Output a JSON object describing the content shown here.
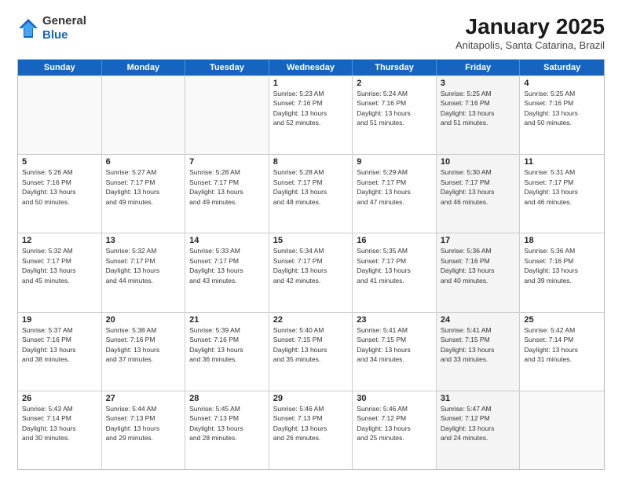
{
  "header": {
    "logo_general": "General",
    "logo_blue": "Blue",
    "month_title": "January 2025",
    "subtitle": "Anitapolis, Santa Catarina, Brazil"
  },
  "weekdays": [
    "Sunday",
    "Monday",
    "Tuesday",
    "Wednesday",
    "Thursday",
    "Friday",
    "Saturday"
  ],
  "rows": [
    [
      {
        "day": "",
        "lines": [],
        "empty": true
      },
      {
        "day": "",
        "lines": [],
        "empty": true
      },
      {
        "day": "",
        "lines": [],
        "empty": true
      },
      {
        "day": "1",
        "lines": [
          "Sunrise: 5:23 AM",
          "Sunset: 7:16 PM",
          "Daylight: 13 hours",
          "and 52 minutes."
        ]
      },
      {
        "day": "2",
        "lines": [
          "Sunrise: 5:24 AM",
          "Sunset: 7:16 PM",
          "Daylight: 13 hours",
          "and 51 minutes."
        ]
      },
      {
        "day": "3",
        "lines": [
          "Sunrise: 5:25 AM",
          "Sunset: 7:16 PM",
          "Daylight: 13 hours",
          "and 51 minutes."
        ],
        "shaded": true
      },
      {
        "day": "4",
        "lines": [
          "Sunrise: 5:25 AM",
          "Sunset: 7:16 PM",
          "Daylight: 13 hours",
          "and 50 minutes."
        ]
      }
    ],
    [
      {
        "day": "5",
        "lines": [
          "Sunrise: 5:26 AM",
          "Sunset: 7:16 PM",
          "Daylight: 13 hours",
          "and 50 minutes."
        ]
      },
      {
        "day": "6",
        "lines": [
          "Sunrise: 5:27 AM",
          "Sunset: 7:17 PM",
          "Daylight: 13 hours",
          "and 49 minutes."
        ]
      },
      {
        "day": "7",
        "lines": [
          "Sunrise: 5:28 AM",
          "Sunset: 7:17 PM",
          "Daylight: 13 hours",
          "and 49 minutes."
        ]
      },
      {
        "day": "8",
        "lines": [
          "Sunrise: 5:28 AM",
          "Sunset: 7:17 PM",
          "Daylight: 13 hours",
          "and 48 minutes."
        ]
      },
      {
        "day": "9",
        "lines": [
          "Sunrise: 5:29 AM",
          "Sunset: 7:17 PM",
          "Daylight: 13 hours",
          "and 47 minutes."
        ]
      },
      {
        "day": "10",
        "lines": [
          "Sunrise: 5:30 AM",
          "Sunset: 7:17 PM",
          "Daylight: 13 hours",
          "and 46 minutes."
        ],
        "shaded": true
      },
      {
        "day": "11",
        "lines": [
          "Sunrise: 5:31 AM",
          "Sunset: 7:17 PM",
          "Daylight: 13 hours",
          "and 46 minutes."
        ]
      }
    ],
    [
      {
        "day": "12",
        "lines": [
          "Sunrise: 5:32 AM",
          "Sunset: 7:17 PM",
          "Daylight: 13 hours",
          "and 45 minutes."
        ]
      },
      {
        "day": "13",
        "lines": [
          "Sunrise: 5:32 AM",
          "Sunset: 7:17 PM",
          "Daylight: 13 hours",
          "and 44 minutes."
        ]
      },
      {
        "day": "14",
        "lines": [
          "Sunrise: 5:33 AM",
          "Sunset: 7:17 PM",
          "Daylight: 13 hours",
          "and 43 minutes."
        ]
      },
      {
        "day": "15",
        "lines": [
          "Sunrise: 5:34 AM",
          "Sunset: 7:17 PM",
          "Daylight: 13 hours",
          "and 42 minutes."
        ]
      },
      {
        "day": "16",
        "lines": [
          "Sunrise: 5:35 AM",
          "Sunset: 7:17 PM",
          "Daylight: 13 hours",
          "and 41 minutes."
        ]
      },
      {
        "day": "17",
        "lines": [
          "Sunrise: 5:36 AM",
          "Sunset: 7:16 PM",
          "Daylight: 13 hours",
          "and 40 minutes."
        ],
        "shaded": true
      },
      {
        "day": "18",
        "lines": [
          "Sunrise: 5:36 AM",
          "Sunset: 7:16 PM",
          "Daylight: 13 hours",
          "and 39 minutes."
        ]
      }
    ],
    [
      {
        "day": "19",
        "lines": [
          "Sunrise: 5:37 AM",
          "Sunset: 7:16 PM",
          "Daylight: 13 hours",
          "and 38 minutes."
        ]
      },
      {
        "day": "20",
        "lines": [
          "Sunrise: 5:38 AM",
          "Sunset: 7:16 PM",
          "Daylight: 13 hours",
          "and 37 minutes."
        ]
      },
      {
        "day": "21",
        "lines": [
          "Sunrise: 5:39 AM",
          "Sunset: 7:16 PM",
          "Daylight: 13 hours",
          "and 36 minutes."
        ]
      },
      {
        "day": "22",
        "lines": [
          "Sunrise: 5:40 AM",
          "Sunset: 7:15 PM",
          "Daylight: 13 hours",
          "and 35 minutes."
        ]
      },
      {
        "day": "23",
        "lines": [
          "Sunrise: 5:41 AM",
          "Sunset: 7:15 PM",
          "Daylight: 13 hours",
          "and 34 minutes."
        ]
      },
      {
        "day": "24",
        "lines": [
          "Sunrise: 5:41 AM",
          "Sunset: 7:15 PM",
          "Daylight: 13 hours",
          "and 33 minutes."
        ],
        "shaded": true
      },
      {
        "day": "25",
        "lines": [
          "Sunrise: 5:42 AM",
          "Sunset: 7:14 PM",
          "Daylight: 13 hours",
          "and 31 minutes."
        ]
      }
    ],
    [
      {
        "day": "26",
        "lines": [
          "Sunrise: 5:43 AM",
          "Sunset: 7:14 PM",
          "Daylight: 13 hours",
          "and 30 minutes."
        ]
      },
      {
        "day": "27",
        "lines": [
          "Sunrise: 5:44 AM",
          "Sunset: 7:13 PM",
          "Daylight: 13 hours",
          "and 29 minutes."
        ]
      },
      {
        "day": "28",
        "lines": [
          "Sunrise: 5:45 AM",
          "Sunset: 7:13 PM",
          "Daylight: 13 hours",
          "and 28 minutes."
        ]
      },
      {
        "day": "29",
        "lines": [
          "Sunrise: 5:46 AM",
          "Sunset: 7:13 PM",
          "Daylight: 13 hours",
          "and 26 minutes."
        ]
      },
      {
        "day": "30",
        "lines": [
          "Sunrise: 5:46 AM",
          "Sunset: 7:12 PM",
          "Daylight: 13 hours",
          "and 25 minutes."
        ]
      },
      {
        "day": "31",
        "lines": [
          "Sunrise: 5:47 AM",
          "Sunset: 7:12 PM",
          "Daylight: 13 hours",
          "and 24 minutes."
        ],
        "shaded": true
      },
      {
        "day": "",
        "lines": [],
        "empty": true
      }
    ]
  ]
}
